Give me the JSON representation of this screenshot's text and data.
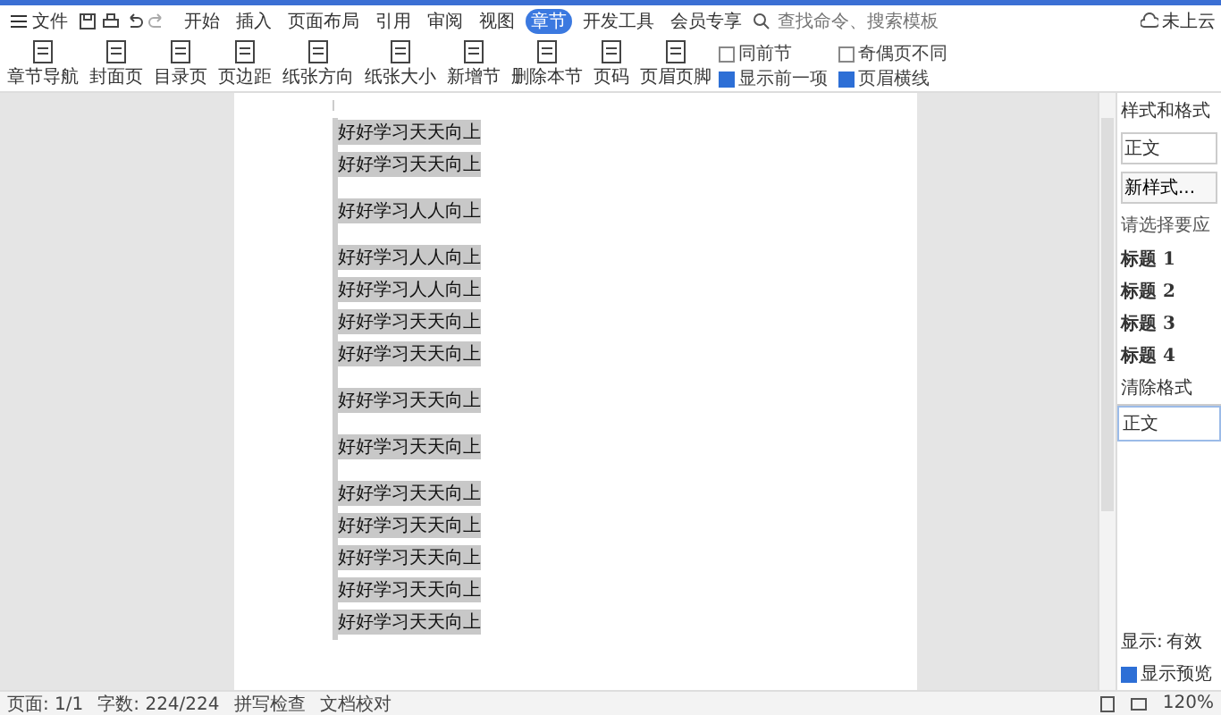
{
  "menu": {
    "file": "文件",
    "tabs": [
      {
        "label": "开始",
        "selected": false
      },
      {
        "label": "插入",
        "selected": false
      },
      {
        "label": "页面布局",
        "selected": false
      },
      {
        "label": "引用",
        "selected": false
      },
      {
        "label": "审阅",
        "selected": false
      },
      {
        "label": "视图",
        "selected": false
      },
      {
        "label": "章节",
        "selected": true
      },
      {
        "label": "开发工具",
        "selected": false
      },
      {
        "label": "会员专享",
        "selected": false
      }
    ],
    "search": {
      "placeholder": "查找命令、搜索模板"
    },
    "share": "未上云"
  },
  "toolbar": [
    {
      "label": "章节导航",
      "kind": "big"
    },
    {
      "label": "封面页",
      "kind": "big"
    },
    {
      "label": "目录页",
      "kind": "big"
    },
    {
      "label": "页边距",
      "kind": "big"
    },
    {
      "label": "纸张方向",
      "kind": "big"
    },
    {
      "label": "纸张大小",
      "kind": "big"
    },
    {
      "label": "新增节",
      "kind": "big"
    },
    {
      "label": "删除本节",
      "kind": "big"
    },
    {
      "label": "页码",
      "kind": "big"
    },
    {
      "label": "页眉页脚",
      "kind": "big"
    }
  ],
  "toolbar_checks": [
    {
      "label": "同前节",
      "checked": false
    },
    {
      "label": "奇偶页不同",
      "checked": false
    },
    {
      "label": "显示前一项",
      "checked": true
    },
    {
      "label": "页眉横线",
      "checked": true
    }
  ],
  "document": {
    "lines": [
      {
        "text": "好好学习天天向上",
        "gap": false
      },
      {
        "text": "好好学习天天向上",
        "gap": false
      },
      {
        "text": "好好学习人人向上",
        "gap": true
      },
      {
        "text": "好好学习人人向上",
        "gap": true
      },
      {
        "text": "好好学习人人向上",
        "gap": false
      },
      {
        "text": "好好学习天天向上",
        "gap": false
      },
      {
        "text": "好好学习天天向上",
        "gap": false
      },
      {
        "text": "好好学习天天向上",
        "gap": true
      },
      {
        "text": "好好学习天天向上",
        "gap": true
      },
      {
        "text": "好好学习天天向上",
        "gap": true
      },
      {
        "text": "好好学习天天向上",
        "gap": false
      },
      {
        "text": "好好学习天天向上",
        "gap": false
      },
      {
        "text": "好好学习天天向上",
        "gap": false
      },
      {
        "text": "好好学习天天向上",
        "gap": false
      }
    ]
  },
  "styles_panel": {
    "title": "样式和格式",
    "current": "正文",
    "new_style": "新样式...",
    "hint": "请选择要应",
    "styles": [
      "标题 1",
      "标题 2",
      "标题 3",
      "标题 4"
    ],
    "clear": "清除格式",
    "selected_style": "正文",
    "show_label": "显示:",
    "show_value": "有效",
    "preview": {
      "label": "显示预览",
      "checked": true
    }
  },
  "status_bar": {
    "page": "页面: 1/1",
    "words": "字数: 224/224",
    "spell": "拼写检查",
    "proof": "文档校对",
    "zoom": "120%"
  }
}
